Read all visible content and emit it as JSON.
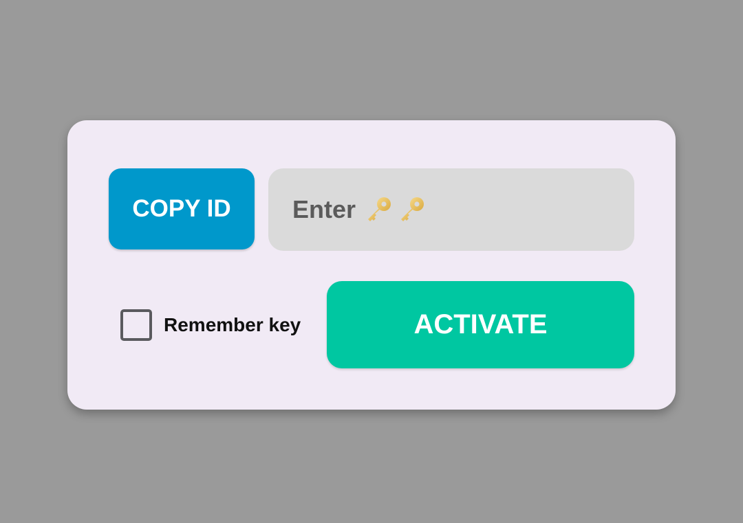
{
  "dialog": {
    "copy_id_button": {
      "label": "COPY ID",
      "color": "#0098cb"
    },
    "key_input": {
      "placeholder_text": "Enter",
      "icons": [
        "key-icon",
        "key-icon"
      ],
      "value": ""
    },
    "remember_checkbox": {
      "label": "Remember key",
      "checked": false
    },
    "activate_button": {
      "label": "ACTIVATE",
      "color": "#00c7a1"
    }
  }
}
